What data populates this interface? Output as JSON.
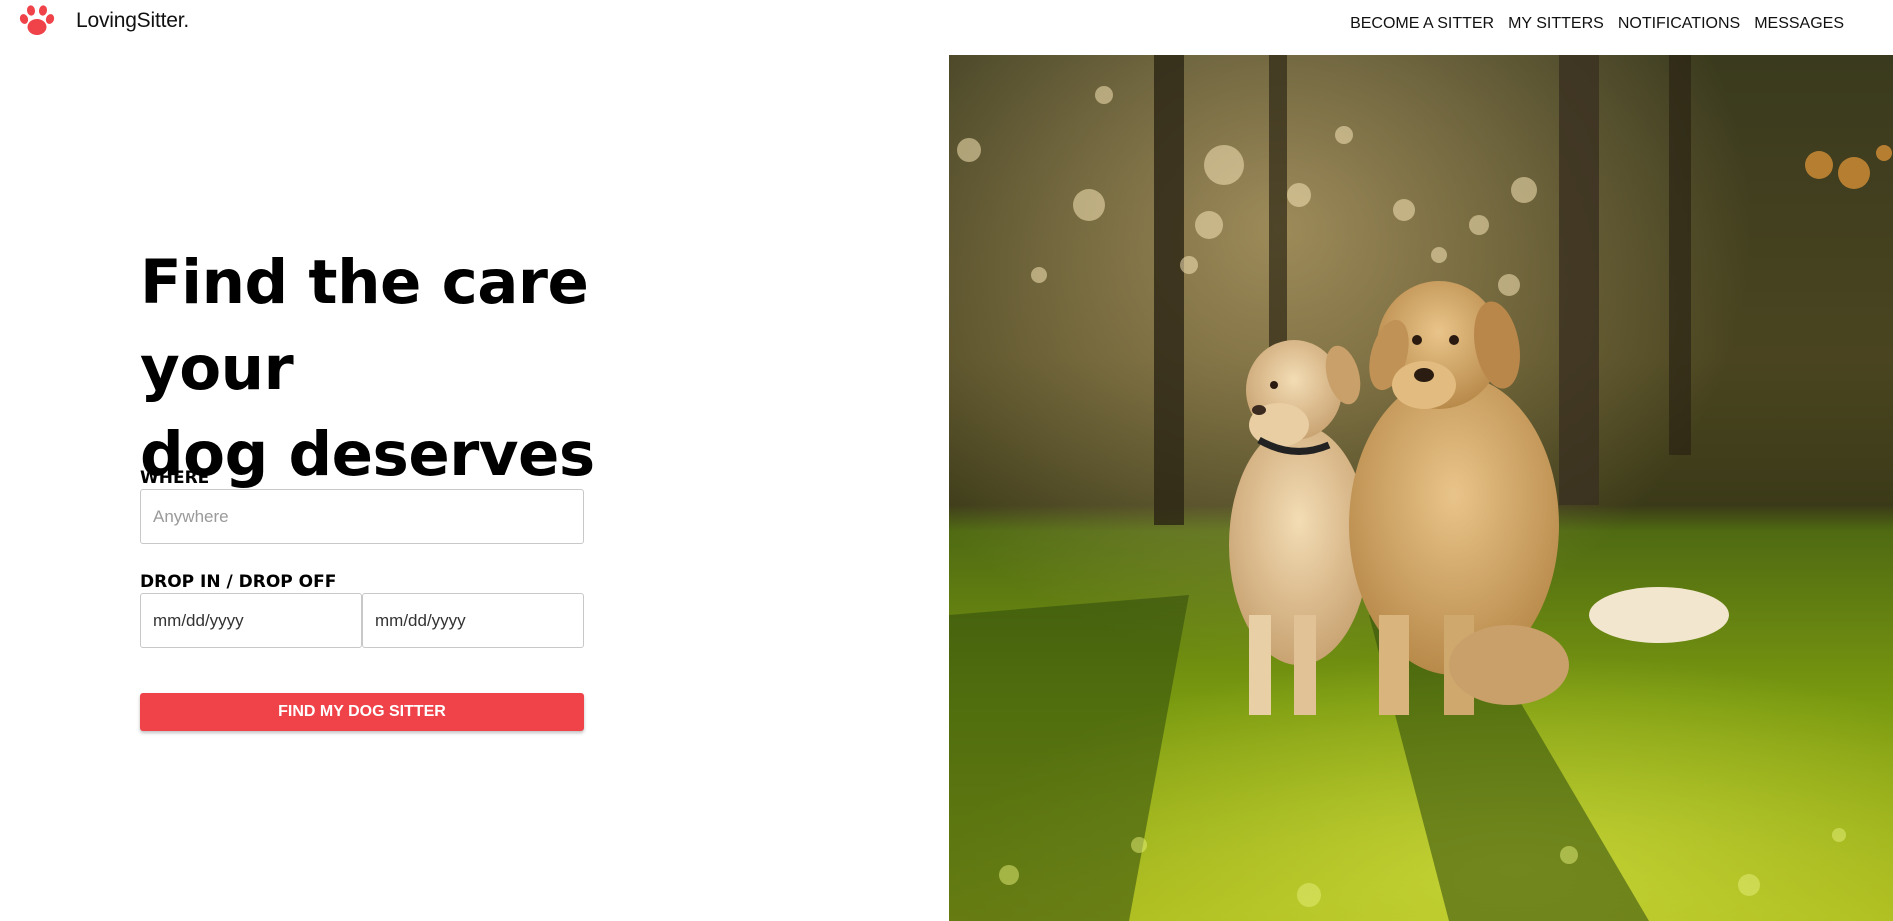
{
  "brand": {
    "name": "LovingSitter.",
    "logo_icon": "paw-icon",
    "accent_color": "#ef4249"
  },
  "nav": {
    "items": [
      {
        "label": "BECOME A SITTER"
      },
      {
        "label": "MY SITTERS"
      },
      {
        "label": "NOTIFICATIONS"
      },
      {
        "label": "MESSAGES"
      }
    ]
  },
  "hero": {
    "headline_line1": "Find the care your",
    "headline_line2": "dog deserves",
    "image_subject": "two dogs sitting on sunlit grass"
  },
  "form": {
    "where_label": "WHERE",
    "where_placeholder": "Anywhere",
    "dates_label": "DROP IN / DROP OFF",
    "drop_in_value": "mm/dd/yyyy",
    "drop_off_value": "mm/dd/yyyy",
    "submit_label": "FIND MY DOG SITTER"
  }
}
